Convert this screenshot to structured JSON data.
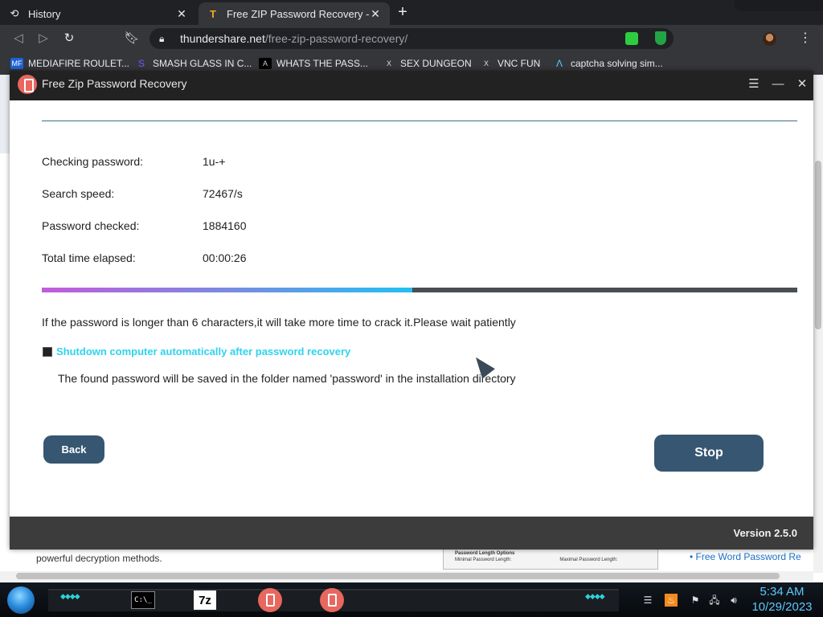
{
  "browser": {
    "tabs": [
      {
        "title": "History",
        "icon": "history-icon"
      },
      {
        "title": "Free ZIP Password Recovery - A sc",
        "icon": "thundershare-favicon"
      }
    ],
    "new_tab": "+",
    "url_host": "thundershare.net",
    "url_path": "/free-zip-password-recovery/",
    "bookmarks": [
      {
        "label": "MEDIAFIRE ROULET...",
        "icon": "MF"
      },
      {
        "label": "SMASH GLASS IN C...",
        "icon": "S"
      },
      {
        "label": "WHATS THE PASS...",
        "icon": "A"
      },
      {
        "label": "SEX DUNGEON",
        "icon": "X"
      },
      {
        "label": "VNC FUN",
        "icon": "X"
      },
      {
        "label": "captcha solving sim...",
        "icon": "Λ"
      }
    ]
  },
  "page_behind": {
    "description": "powerful decryption methods.",
    "screenshot_text": "Password Length Options",
    "screenshot_min": "Minimal Password Length:",
    "screenshot_max": "Maximal Password Length:",
    "link": "• Free Word Password Re"
  },
  "app": {
    "title": "Free Zip Password Recovery",
    "info": [
      {
        "label": "Checking password:",
        "value": "1u-+"
      },
      {
        "label": "Search speed:",
        "value": "72467/s"
      },
      {
        "label": "Password checked:",
        "value": "1884160"
      },
      {
        "label": "Total time elapsed:",
        "value": "00:00:26"
      }
    ],
    "progress": 0.49,
    "notice": "If the password is longer than 6 characters,it will take more time to crack it.Please wait patiently",
    "shutdown_label": "Shutdown computer automatically after password recovery",
    "save_note": "The found password will be saved in the folder named 'password' in the installation directory",
    "back_label": "Back",
    "stop_label": "Stop",
    "version": "Version 2.5.0",
    "colors": {
      "accent": "#2fd3ef",
      "button": "#375672",
      "footer": "#3c3c3c"
    }
  },
  "taskbar": {
    "cmd_text": "C:\\_",
    "sevenzip": "7z",
    "time": "5:34 AM",
    "date": "10/29/2023"
  }
}
